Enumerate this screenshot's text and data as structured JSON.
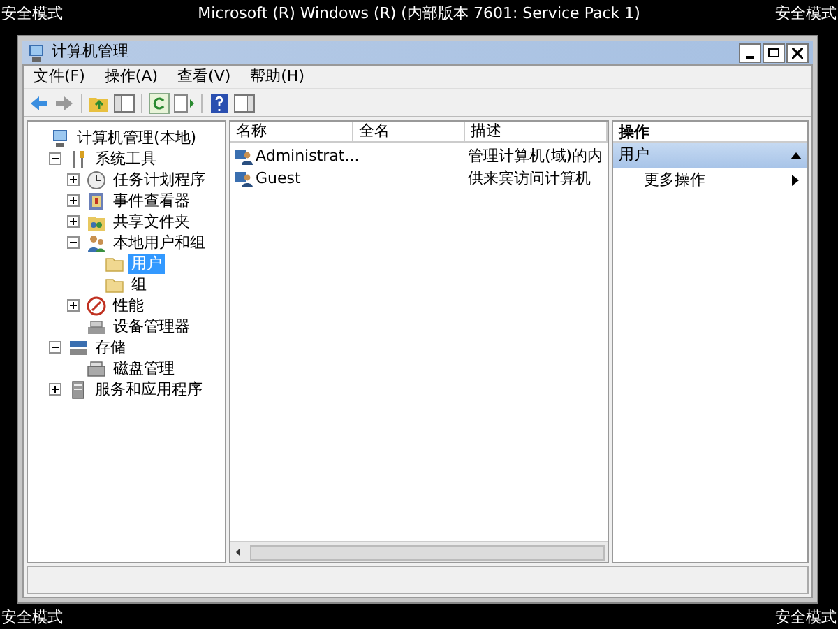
{
  "screen": {
    "corner_labels_top": [
      "安全模式",
      "安全模式"
    ],
    "banner": "Microsoft (R) Windows (R) (内部版本 7601: Service Pack 1)",
    "corner_labels_bottom": [
      "安全模式",
      "安全模式"
    ]
  },
  "window": {
    "title": "计算机管理"
  },
  "menu": [
    "文件(F)",
    "操作(A)",
    "查看(V)",
    "帮助(H)"
  ],
  "tree": [
    {
      "label": "计算机管理(本地)",
      "kind": "computer",
      "selected": false,
      "children": [
        {
          "label": "系统工具",
          "kind": "tools",
          "expanded": true,
          "selected": false,
          "children": [
            {
              "label": "任务计划程序",
              "kind": "clock",
              "expanded": false,
              "selected": false
            },
            {
              "label": "事件查看器",
              "kind": "event",
              "expanded": false,
              "selected": false
            },
            {
              "label": "共享文件夹",
              "kind": "share",
              "expanded": false,
              "selected": false
            },
            {
              "label": "本地用户和组",
              "kind": "users",
              "expanded": true,
              "selected": false,
              "children": [
                {
                  "label": "用户",
                  "kind": "folder",
                  "selected": true
                },
                {
                  "label": "组",
                  "kind": "folder",
                  "selected": false
                }
              ]
            },
            {
              "label": "性能",
              "kind": "perf",
              "expanded": false,
              "selected": false
            },
            {
              "label": "设备管理器",
              "kind": "device",
              "selected": false
            }
          ]
        },
        {
          "label": "存储",
          "kind": "storage",
          "expanded": true,
          "selected": false,
          "children": [
            {
              "label": "磁盘管理",
              "kind": "disk",
              "selected": false
            }
          ]
        },
        {
          "label": "服务和应用程序",
          "kind": "services",
          "expanded": false,
          "selected": false
        }
      ]
    }
  ],
  "table": {
    "columns": [
      "名称",
      "全名",
      "描述"
    ],
    "rows": [
      {
        "name": "Administrat...",
        "description": "管理计算机(域)的内"
      },
      {
        "name": "Guest",
        "description": "供来宾访问计算机"
      }
    ]
  },
  "actions": {
    "title": "操作",
    "sections": [
      {
        "title": "用户",
        "expanded": true,
        "items": [
          {
            "label": "更多操作"
          }
        ]
      }
    ]
  }
}
